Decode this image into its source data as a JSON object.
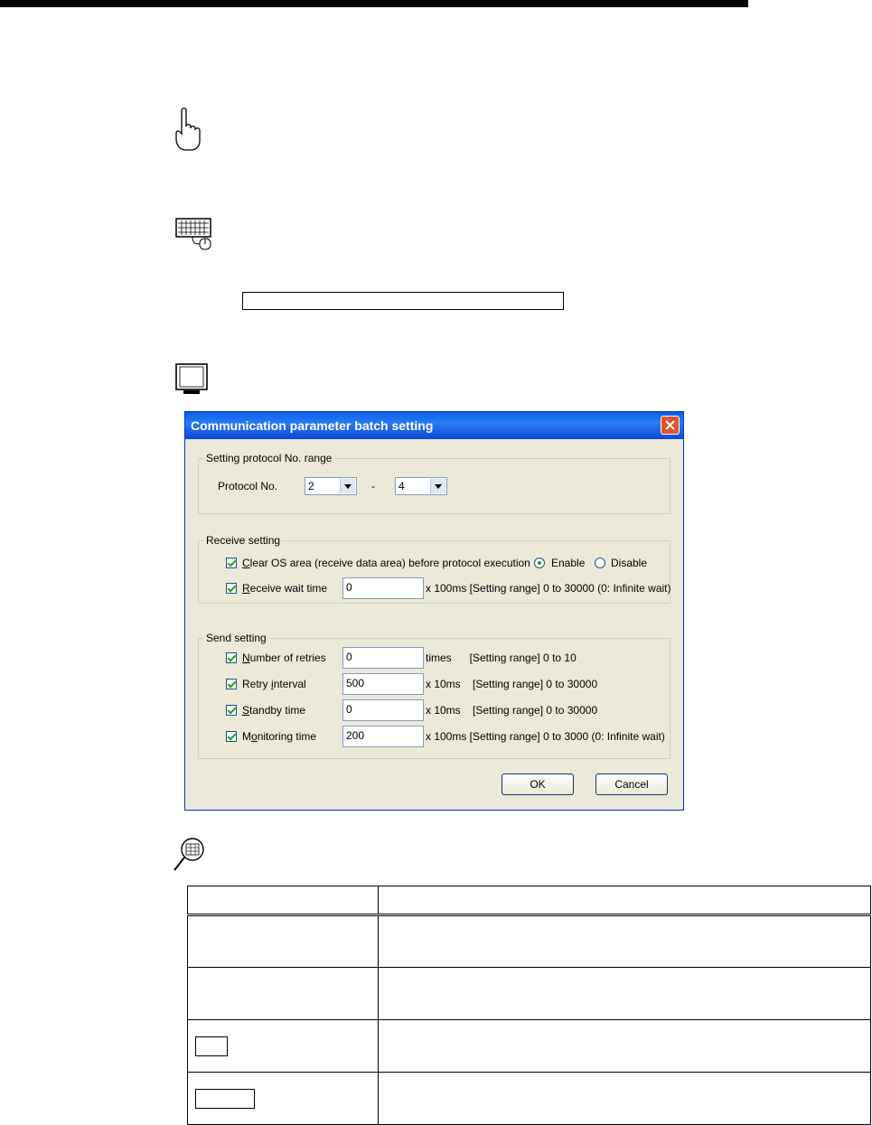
{
  "dialog": {
    "title": "Communication parameter batch setting",
    "protocol_range": {
      "legend": "Setting protocol No. range",
      "label": "Protocol No.",
      "from_value": "2",
      "separator": "-",
      "to_value": "4"
    },
    "receive_setting": {
      "legend": "Receive setting",
      "clear_os": {
        "label_accel": "C",
        "label_rest": "lear OS area (receive data area) before protocol execution",
        "enable_label": "Enable",
        "disable_label": "Disable"
      },
      "receive_wait": {
        "label_accel": "R",
        "label_rest": "eceive wait time",
        "value": "0",
        "unit_range": "x 100ms [Setting range] 0 to 30000 (0: Infinite wait)"
      }
    },
    "send_setting": {
      "legend": "Send setting",
      "rows": [
        {
          "pre": "",
          "accel": "N",
          "post": "umber of retries",
          "value": "0",
          "unit_range": "times      [Setting range] 0 to 10"
        },
        {
          "pre": "Retry ",
          "accel": "i",
          "post": "nterval",
          "value": "500",
          "unit_range": "x 10ms    [Setting range] 0 to 30000"
        },
        {
          "pre": "",
          "accel": "S",
          "post": "tandby time",
          "value": "0",
          "unit_range": "x 10ms    [Setting range] 0 to 30000"
        },
        {
          "pre": "M",
          "accel": "o",
          "post": "nitoring time",
          "value": "200",
          "unit_range": "x 100ms [Setting range] 0 to 3000 (0: Infinite wait)"
        }
      ]
    },
    "ok_label": "OK",
    "cancel_label": "Cancel"
  }
}
